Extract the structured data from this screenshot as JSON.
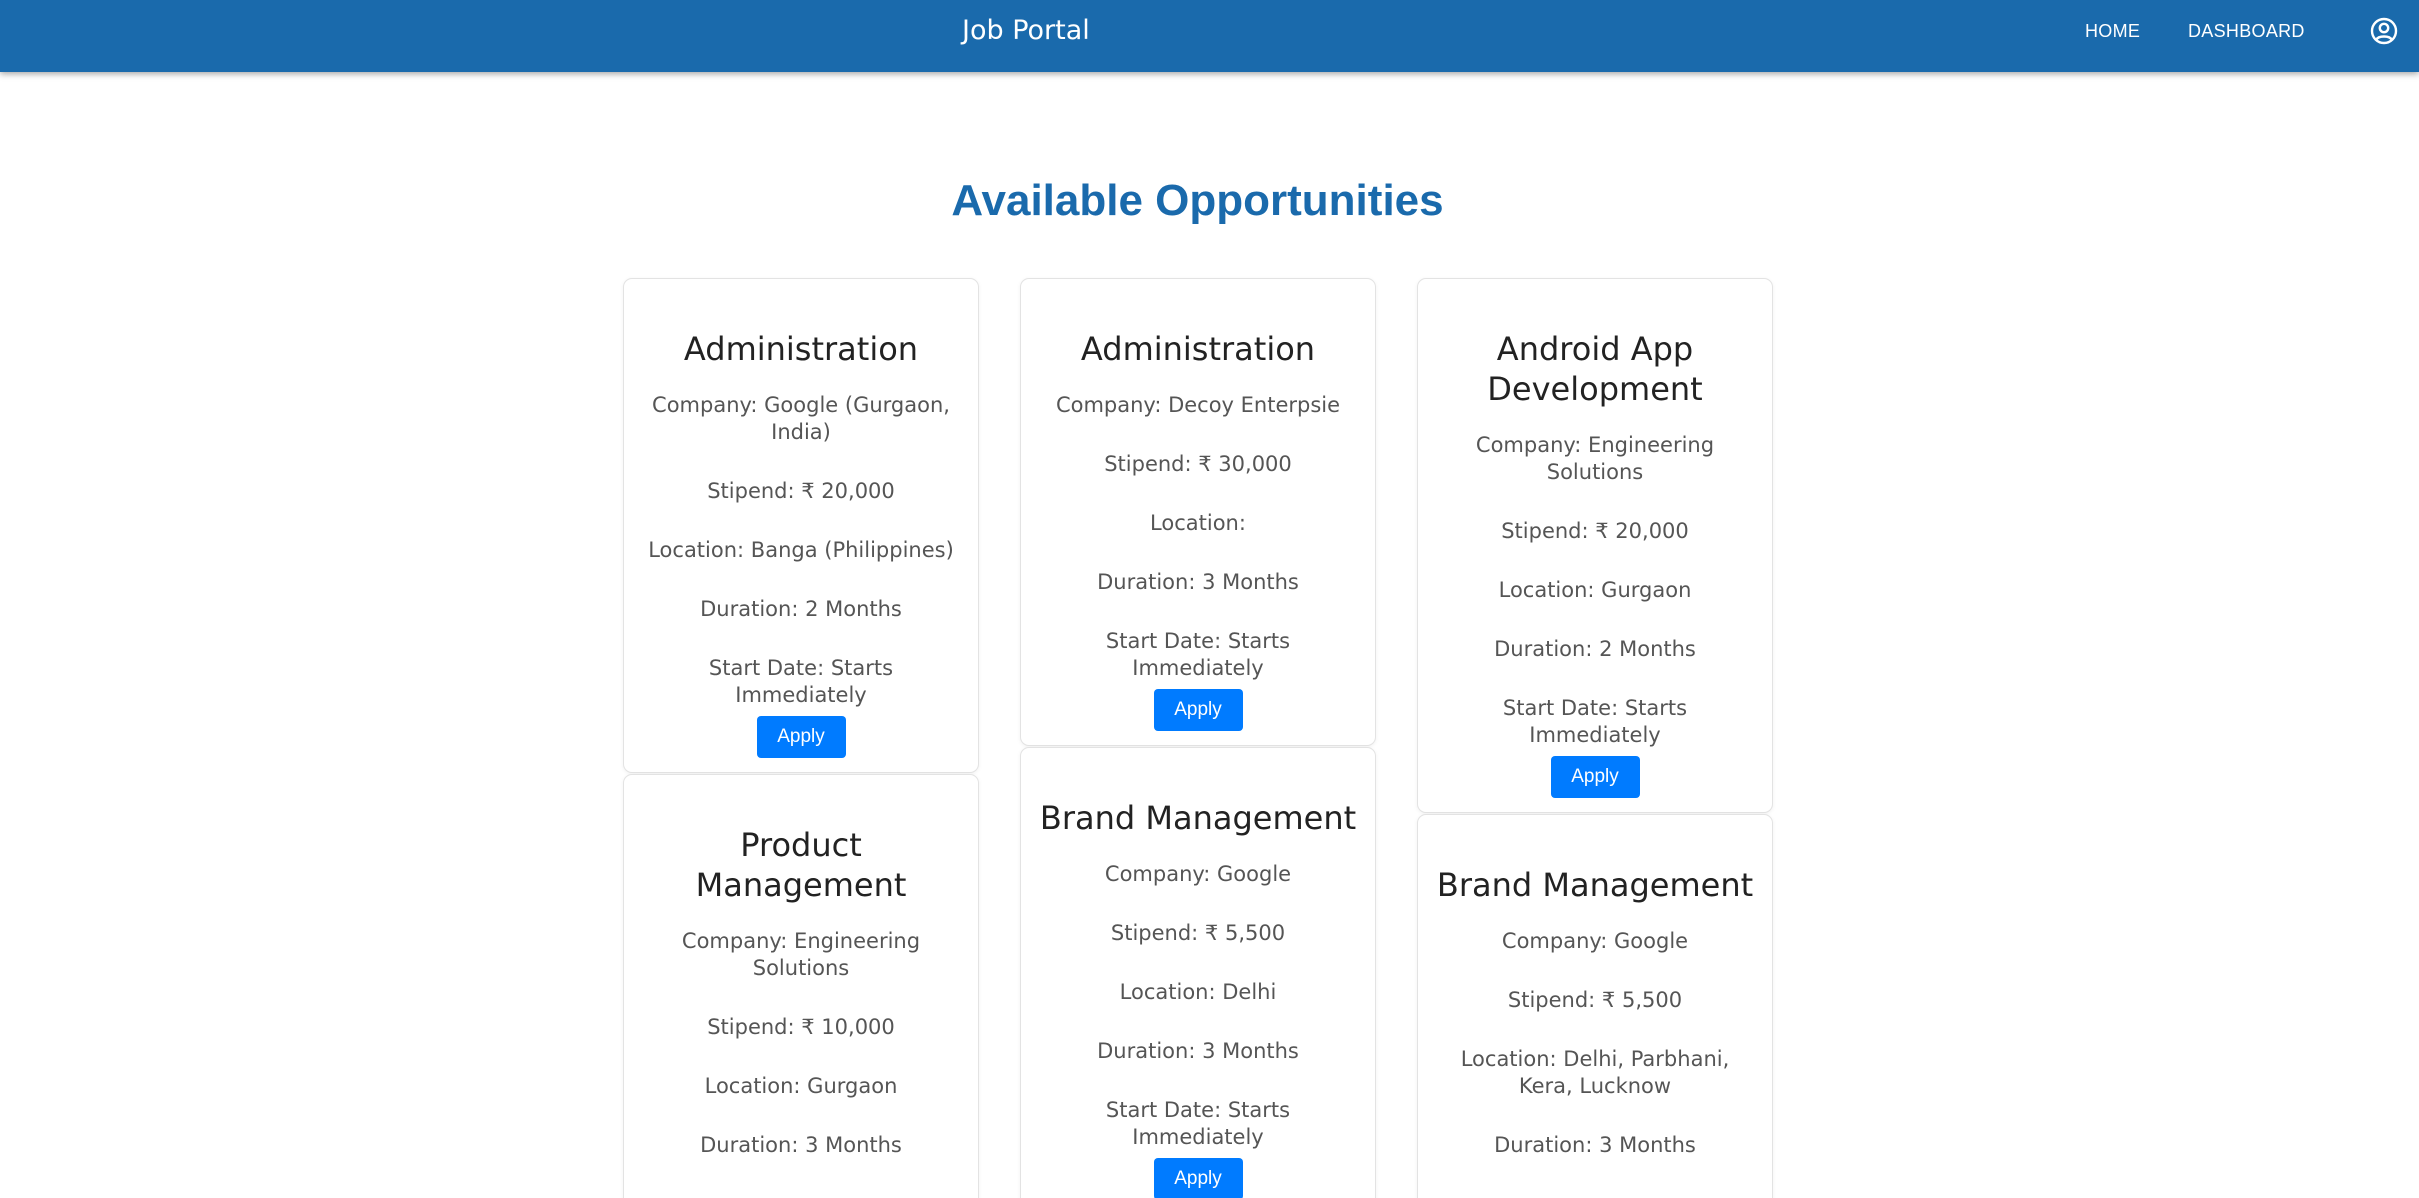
{
  "header": {
    "title": "Job Portal",
    "nav": {
      "home": "HOME",
      "dashboard": "DASHBOARD"
    },
    "account_icon": "account-circle-icon",
    "background_color": "#1a6aac"
  },
  "main": {
    "title": "Available Opportunities",
    "apply_label": "Apply",
    "accent_color": "#007bff",
    "jobs": [
      {
        "title": "Administration",
        "company": "Company: Google (Gurgaon, India)",
        "stipend": "Stipend: ₹ 20,000",
        "location": "Location: Banga (Philippines)",
        "duration": "Duration: 2 Months",
        "start_date": "Start Date: Starts Immediately"
      },
      {
        "title": "Administration",
        "company": "Company: Decoy Enterpsie",
        "stipend": "Stipend: ₹ 30,000",
        "location": "Location:",
        "duration": "Duration: 3 Months",
        "start_date": "Start Date: Starts Immediately"
      },
      {
        "title": "Android App Development",
        "company": "Company: Engineering Solutions",
        "stipend": "Stipend: ₹ 20,000",
        "location": "Location: Gurgaon",
        "duration": "Duration: 2 Months",
        "start_date": "Start Date: Starts Immediately"
      },
      {
        "title": "Product Management",
        "company": "Company: Engineering Solutions",
        "stipend": "Stipend: ₹ 10,000",
        "location": "Location: Gurgaon",
        "duration": "Duration: 3 Months"
      },
      {
        "title": "Brand Management",
        "company": "Company: Google",
        "stipend": "Stipend: ₹ 5,500",
        "location": "Location: Delhi",
        "duration": "Duration: 3 Months",
        "start_date": "Start Date: Starts Immediately"
      },
      {
        "title": "Brand Management",
        "company": "Company: Google",
        "stipend": "Stipend: ₹ 5,500",
        "location": "Location: Delhi, Parbhani, Kera, Lucknow",
        "duration": "Duration: 3 Months"
      }
    ]
  }
}
